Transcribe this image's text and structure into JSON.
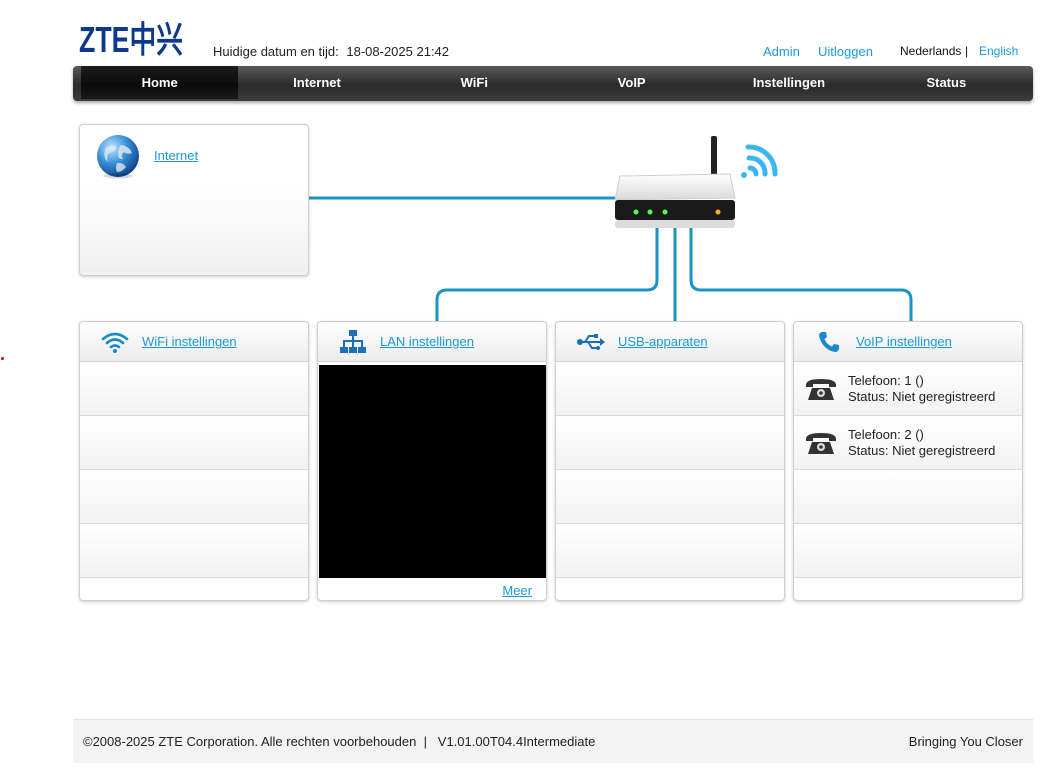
{
  "header": {
    "logo_text": "ZTE中兴",
    "datetime_label": "Huidige datum en tijd:",
    "datetime_value": "18-08-2025 21:42",
    "admin": "Admin",
    "logout": "Uitloggen",
    "lang_nl": "Nederlands",
    "lang_sep": "|",
    "lang_en": "English"
  },
  "nav": {
    "items": [
      "Home",
      "Internet",
      "WiFi",
      "VoIP",
      "Instellingen",
      "Status"
    ],
    "active": "Home"
  },
  "internet_panel": {
    "link": "Internet"
  },
  "cards": {
    "wifi": {
      "title": "WiFi instellingen"
    },
    "lan": {
      "title": "LAN instellingen",
      "more": "Meer"
    },
    "usb": {
      "title": "USB-apparaten"
    },
    "voip": {
      "title": "VoIP instellingen",
      "phones": [
        {
          "line": "Telefoon: 1 ()",
          "status": "Status: Niet geregistreerd"
        },
        {
          "line": "Telefoon: 2 ()",
          "status": "Status: Niet geregistreerd"
        }
      ]
    }
  },
  "footer": {
    "copyright": "©2008-2025 ZTE Corporation. Alle rechten voorbehouden  |   V1.01.00T04.4Intermediate",
    "slogan": "Bringing You Closer"
  },
  "colors": {
    "accent": "#1a9ad6",
    "line": "#1b93c4",
    "nav_dark": "#2a2a2a",
    "logo": "#0b3a8c"
  }
}
